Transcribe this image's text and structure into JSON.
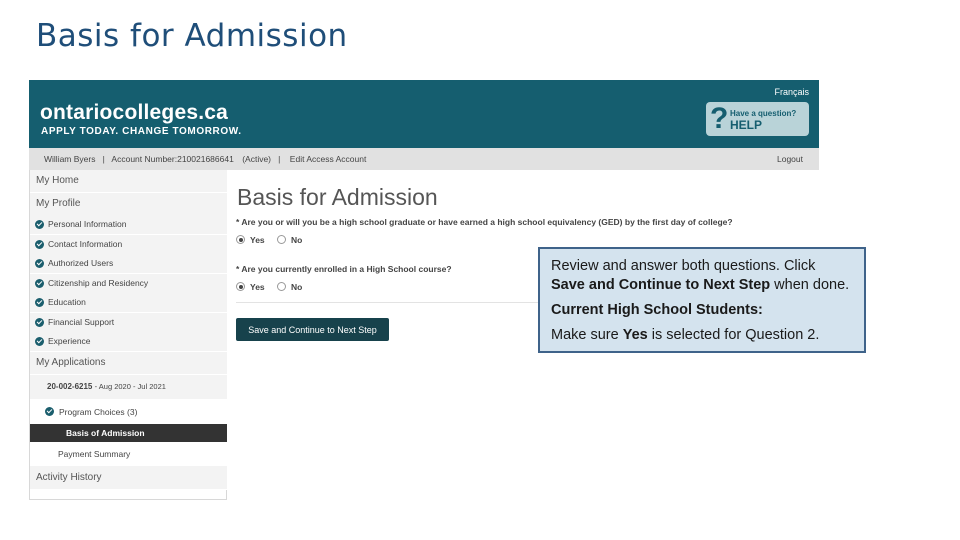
{
  "slide_title": "Basis for Admission",
  "header": {
    "logo_main": "ontariocolleges.ca",
    "logo_tagline": "APPLY TODAY. CHANGE TOMORROW.",
    "language_link": "Français",
    "help_small": "Have a question?",
    "help_big": "HELP",
    "help_icon": "question-mark-icon"
  },
  "account_bar": {
    "user_name": "William Byers",
    "account_number": "Account Number:210021686641",
    "status": "(Active)",
    "edit_link": "Edit Access Account",
    "logout": "Logout"
  },
  "sidebar": {
    "my_home": "My Home",
    "my_profile": "My Profile",
    "profile_items": [
      "Personal Information",
      "Contact Information",
      "Authorized Users",
      "Citizenship and Residency",
      "Education",
      "Financial Support",
      "Experience"
    ],
    "my_applications": "My Applications",
    "application_id": "20-002-6215",
    "application_dates": "- Aug 2020 - Jul 2021",
    "program_choices": "Program Choices (3)",
    "basis_for_admission": "Basis of Admission",
    "payment_summary": "Payment Summary",
    "activity_history": "Activity History",
    "check_icon": "check-circle-icon"
  },
  "main": {
    "page_title": "Basis for Admission",
    "question1": "* Are you or will you be a high school graduate or have earned a high school equivalency (GED) by the first day of college?",
    "question1_selected": "Yes",
    "question2": "* Are you currently enrolled in a High School course?",
    "question2_selected": "Yes",
    "yes_label": "Yes",
    "no_label": "No",
    "save_button": "Save and Continue to Next Step"
  },
  "callout": {
    "line1_a": "Review and answer both questions. Click ",
    "line1_b": "Save and Continue to Next Step",
    "line1_c": " when done.",
    "heading": "Current High School Students:",
    "line3_a": "Make sure ",
    "line3_b": "Yes",
    "line3_c": " is selected for Question 2."
  },
  "colors": {
    "header_teal": "#155e6f",
    "button_dark": "#17424c",
    "title_blue": "#1f4e79",
    "callout_bg": "#d4e3ee",
    "callout_border": "#3f638a"
  }
}
